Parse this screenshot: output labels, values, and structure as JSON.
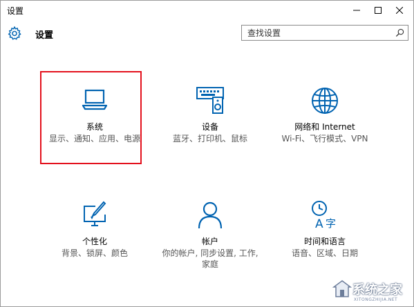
{
  "window": {
    "title": "设置"
  },
  "header": {
    "title": "设置"
  },
  "search": {
    "placeholder": "查找设置"
  },
  "tiles": [
    {
      "name": "系统",
      "desc": "显示、通知、应用、电源",
      "icon": "laptop-icon"
    },
    {
      "name": "设备",
      "desc": "蓝牙、打印机、鼠标",
      "icon": "keyboard-speaker-icon"
    },
    {
      "name": "网络和 Internet",
      "desc": "Wi-Fi、飞行模式、VPN",
      "icon": "globe-icon"
    },
    {
      "name": "个性化",
      "desc": "背景、锁屏、颜色",
      "icon": "monitor-brush-icon"
    },
    {
      "name": "帐户",
      "desc": "你的帐户, 同步设置, 工作, 家庭",
      "icon": "person-icon"
    },
    {
      "name": "时间和语言",
      "desc": "语音、区域、日期",
      "icon": "clock-language-icon"
    }
  ],
  "colors": {
    "accent": "#0063b1",
    "highlight": "#e3101c"
  },
  "watermark": {
    "text": "系统之家",
    "sub": "XITONGZHIJIA.NET"
  }
}
